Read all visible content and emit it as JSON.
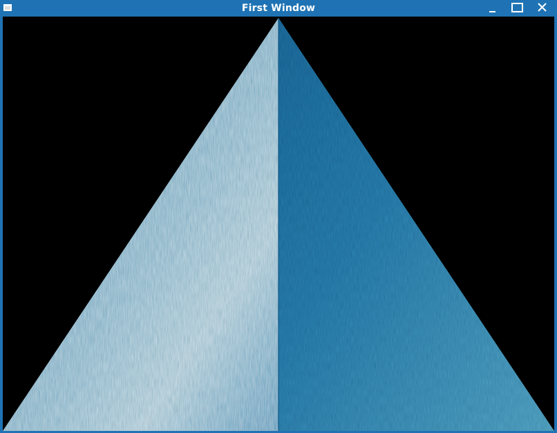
{
  "window": {
    "title": "First Window"
  },
  "titlebar": {
    "icons": {
      "app": "window-icon",
      "minimize": "minimize-icon",
      "maximize": "maximize-icon",
      "close": "close-icon"
    }
  },
  "scene": {
    "background_color": "#000000",
    "left_face_base": "#5fa8c8",
    "left_face_light": "#c9dfe6",
    "right_face_base": "#2d86b3",
    "right_face_dark": "#125e93"
  }
}
